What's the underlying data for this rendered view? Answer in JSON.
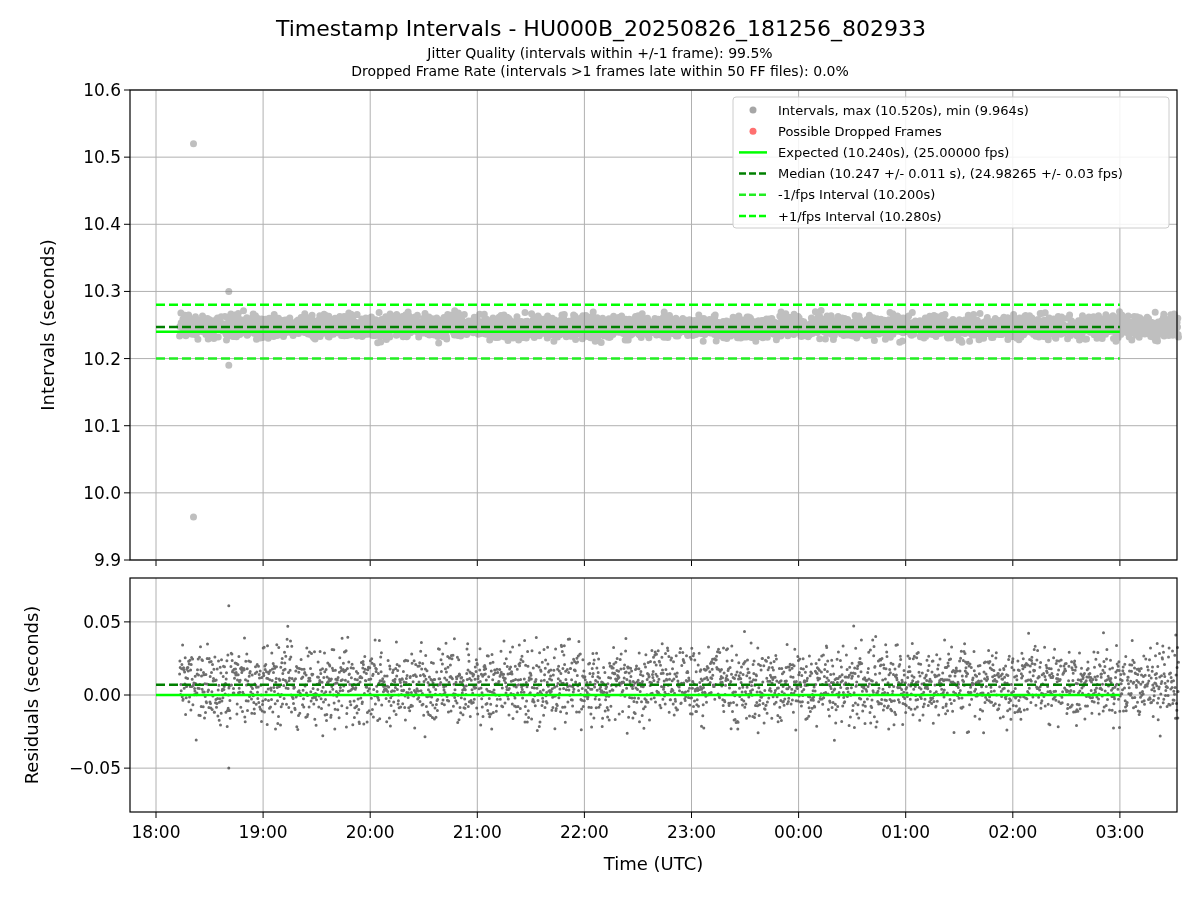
{
  "title": "Timestamp Intervals - HU000B_20250826_181256_802933",
  "subtitles": [
    "Jitter Quality (intervals within +/-1 frame): 99.5%",
    "Dropped Frame Rate (intervals >1 frames late within 50 FF files): 0.0%"
  ],
  "intervals_plot": {
    "chart_data": {
      "type": "line",
      "ylabel": "Intervals (seconds)",
      "ylim": [
        9.9,
        10.6
      ],
      "grid": true,
      "legend": true,
      "yticks": [
        {
          "value": 9.9,
          "label": "9.9"
        },
        {
          "value": 10.0,
          "label": "10.0"
        },
        {
          "value": 10.1,
          "label": "10.1"
        },
        {
          "value": 10.2,
          "label": "10.2"
        },
        {
          "value": 10.3,
          "label": "10.3"
        },
        {
          "value": 10.4,
          "label": "10.4"
        },
        {
          "value": 10.5,
          "label": "10.5"
        },
        {
          "value": 10.6,
          "label": "10.6"
        }
      ],
      "series": [
        {
          "name": "Expected (10.240s), (25.00000 fps)",
          "color": "#00ff00",
          "line_style": "solid",
          "values": [
            10.24,
            10.24,
            10.24,
            10.24,
            10.24,
            10.24,
            10.24,
            10.24,
            10.24,
            10.24
          ]
        },
        {
          "name": "Median (10.247 +/- 0.011 s), (24.98265 +/- 0.03 fps)",
          "color": "#008000",
          "line_style": "dashed",
          "values": [
            10.247,
            10.247,
            10.247,
            10.247,
            10.247,
            10.247,
            10.247,
            10.247,
            10.247,
            10.247
          ]
        },
        {
          "name": "-1/fps Interval (10.200s)",
          "color": "#22ee22",
          "line_style": "dashed",
          "values": [
            10.2,
            10.2,
            10.2,
            10.2,
            10.2,
            10.2,
            10.2,
            10.2,
            10.2,
            10.2
          ]
        },
        {
          "name": "+1/fps Interval (10.280s)",
          "color": "#00ff00",
          "line_style": "dashed",
          "values": [
            10.28,
            10.28,
            10.28,
            10.28,
            10.28,
            10.28,
            10.28,
            10.28,
            10.28,
            10.28
          ]
        }
      ]
    },
    "legend": [
      {
        "kind": "point",
        "color": "#a6a6a6",
        "label": "Intervals, max (10.520s), min (9.964s)"
      },
      {
        "kind": "point",
        "color": "#ff7070",
        "label": "Possible Dropped Frames"
      }
    ]
  },
  "residuals_plot": {
    "chart_data": {
      "type": "line",
      "xlabel": "Time (UTC)",
      "ylabel": "Residuals (seconds)",
      "ylim": [
        -0.08,
        0.08
      ],
      "grid": true,
      "categories": [
        "18:00",
        "19:00",
        "20:00",
        "21:00",
        "22:00",
        "23:00",
        "00:00",
        "01:00",
        "02:00",
        "03:00"
      ],
      "yticks": [
        {
          "value": -0.05,
          "label": "−0.05"
        },
        {
          "value": 0,
          "label": "0.00"
        },
        {
          "value": 0.05,
          "label": "0.05"
        }
      ],
      "series": [
        {
          "color": "#00ff00",
          "line_style": "solid",
          "values": [
            0,
            0,
            0,
            0,
            0,
            0,
            0,
            0,
            0,
            0
          ]
        },
        {
          "color": "#008000",
          "line_style": "dashed",
          "values": [
            0.007,
            0.007,
            0.007,
            0.007,
            0.007,
            0.007,
            0.007,
            0.007,
            0.007,
            0.007
          ]
        }
      ]
    }
  }
}
